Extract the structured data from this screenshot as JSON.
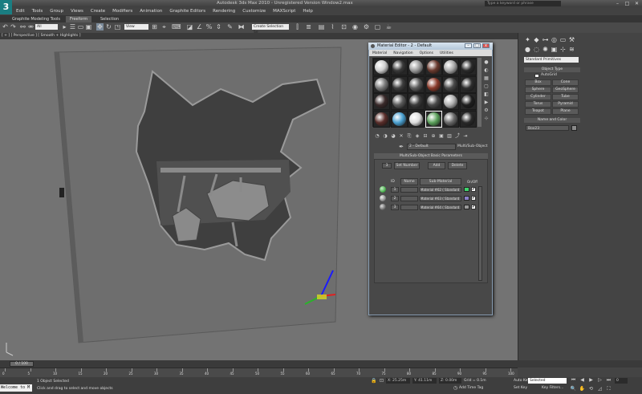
{
  "window": {
    "title": "Autodesk 3ds Max  2010    -  Unregistered Version    Window2.max",
    "logo_text": "3",
    "help_search_placeholder": "Type a keyword or phrase",
    "controls": [
      "–",
      "□",
      "✕"
    ]
  },
  "menu": [
    "Edit",
    "Tools",
    "Group",
    "Views",
    "Create",
    "Modifiers",
    "Animation",
    "Graphite Editors",
    "Rendering",
    "Customize",
    "MAXScript",
    "Help"
  ],
  "ribbon": {
    "app_label": "Graphite Modeling Tools",
    "tabs": [
      "Freeform",
      "Selection"
    ]
  },
  "toolbar": {
    "filter_value": "All",
    "coord_value": "View",
    "selection_set_placeholder": "Create Selection Se"
  },
  "viewport": {
    "label": "[ + ] [ Perspective ] [ Smooth + Highlights ]"
  },
  "command_panel": {
    "category": "Standard Primitives",
    "object_type_title": "Object Type",
    "autogrid_label": "AutoGrid",
    "buttons": [
      "Box",
      "Cone",
      "Sphere",
      "GeoSphere",
      "Cylinder",
      "Tube",
      "Torus",
      "Pyramid",
      "Teapot",
      "Plane"
    ],
    "name_color_title": "Name and Color",
    "object_name": "Box23",
    "object_color": "#8a8a8a"
  },
  "material_editor": {
    "title": "Material Editor - 2 - Default",
    "menu": [
      "Material",
      "Navigation",
      "Options",
      "Utilities"
    ],
    "slots": [
      "#cfcfcf",
      "#3a3a3a",
      "#9a9a9a",
      "#6a3a2e",
      "#aaaaaa",
      "#2a2a2a",
      "#7a7a7a",
      "#3e3e3e",
      "#5a5a5a",
      "#8a3a2a",
      "#4a4a4a",
      "#2e2e2e",
      "#3a2a2a",
      "#5a5a5a",
      "#3a3a3a",
      "#4a4a4a",
      "#b0b0b0",
      "#1e1e1e",
      "#5a2e2a",
      "#4aa0d0",
      "#dddddd",
      "#5aa05a",
      "#6a6a6a",
      "#2a2a2a"
    ],
    "material_name": "2 - Default",
    "material_type": "Multi/Sub-Object",
    "rollout_title": "Multi/Sub-Object Basic Parameters",
    "count": "3",
    "set_number_label": "Set Number",
    "add_label": "Add",
    "delete_label": "Delete",
    "col_id": "ID",
    "col_name": "Name",
    "col_submaterial": "Sub-Material",
    "col_onoff": "On/Off",
    "rows": [
      {
        "id": "1",
        "material": "Material #62  ( Standard )",
        "color": "#3fd36b",
        "ball": "#4caf50"
      },
      {
        "id": "2",
        "material": "Material #63  ( Standard )",
        "color": "#8a7fc8",
        "ball": "#8a8a8a"
      },
      {
        "id": "3",
        "material": "Material #64  ( Standard )",
        "color": "#999999",
        "ball": "#6a6a6a"
      }
    ]
  },
  "timeline": {
    "frame": "0 / 100",
    "ticks": [
      "0",
      "5",
      "10",
      "15",
      "20",
      "25",
      "30",
      "35",
      "40",
      "45",
      "50",
      "55",
      "60",
      "65",
      "70",
      "75",
      "80",
      "85",
      "90",
      "95",
      "100"
    ]
  },
  "status": {
    "maxscript": "Welcome to M",
    "selection": "1 Object Selected",
    "prompt": "Click and drag to select and move objects",
    "x": "X: 25.25m",
    "y": "Y: 41.11m",
    "z": "Z: 0.00m",
    "grid": "Grid = 0.1m",
    "add_time_tag": "Add Time Tag",
    "auto_key": "Auto Key",
    "auto_key_value": "Selected",
    "set_key": "Set Key",
    "key_filters": "Key Filters...",
    "frame_field": "0"
  }
}
